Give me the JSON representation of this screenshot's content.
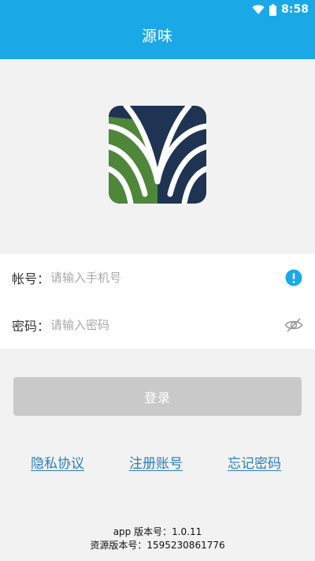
{
  "status_bar": {
    "time": "8:58",
    "icons": [
      "wifi-icon",
      "battery-icon"
    ]
  },
  "header": {
    "title": "源味"
  },
  "logo": {
    "icon": "app-logo",
    "colors": {
      "navy": "#1e3452",
      "green": "#4e873a",
      "white": "#ffffff"
    }
  },
  "form": {
    "account": {
      "label": "帐号：",
      "placeholder": "请输入手机号",
      "value": "",
      "icon": "info-icon"
    },
    "password": {
      "label": "密码：",
      "placeholder": "请输入密码",
      "value": "",
      "icon": "eye-hidden-icon"
    }
  },
  "login_button": {
    "label": "登录"
  },
  "links": {
    "privacy": "隐私协议",
    "register": "注册账号",
    "forgot": "忘记密码"
  },
  "version": {
    "app": "app 版本号：1.0.11",
    "resource": "资源版本号：1595230861776"
  },
  "colors": {
    "primary": "#1aa9e6",
    "link": "#2a7fb8",
    "button_disabled": "#c9c9c9",
    "background": "#f2f2f2"
  }
}
